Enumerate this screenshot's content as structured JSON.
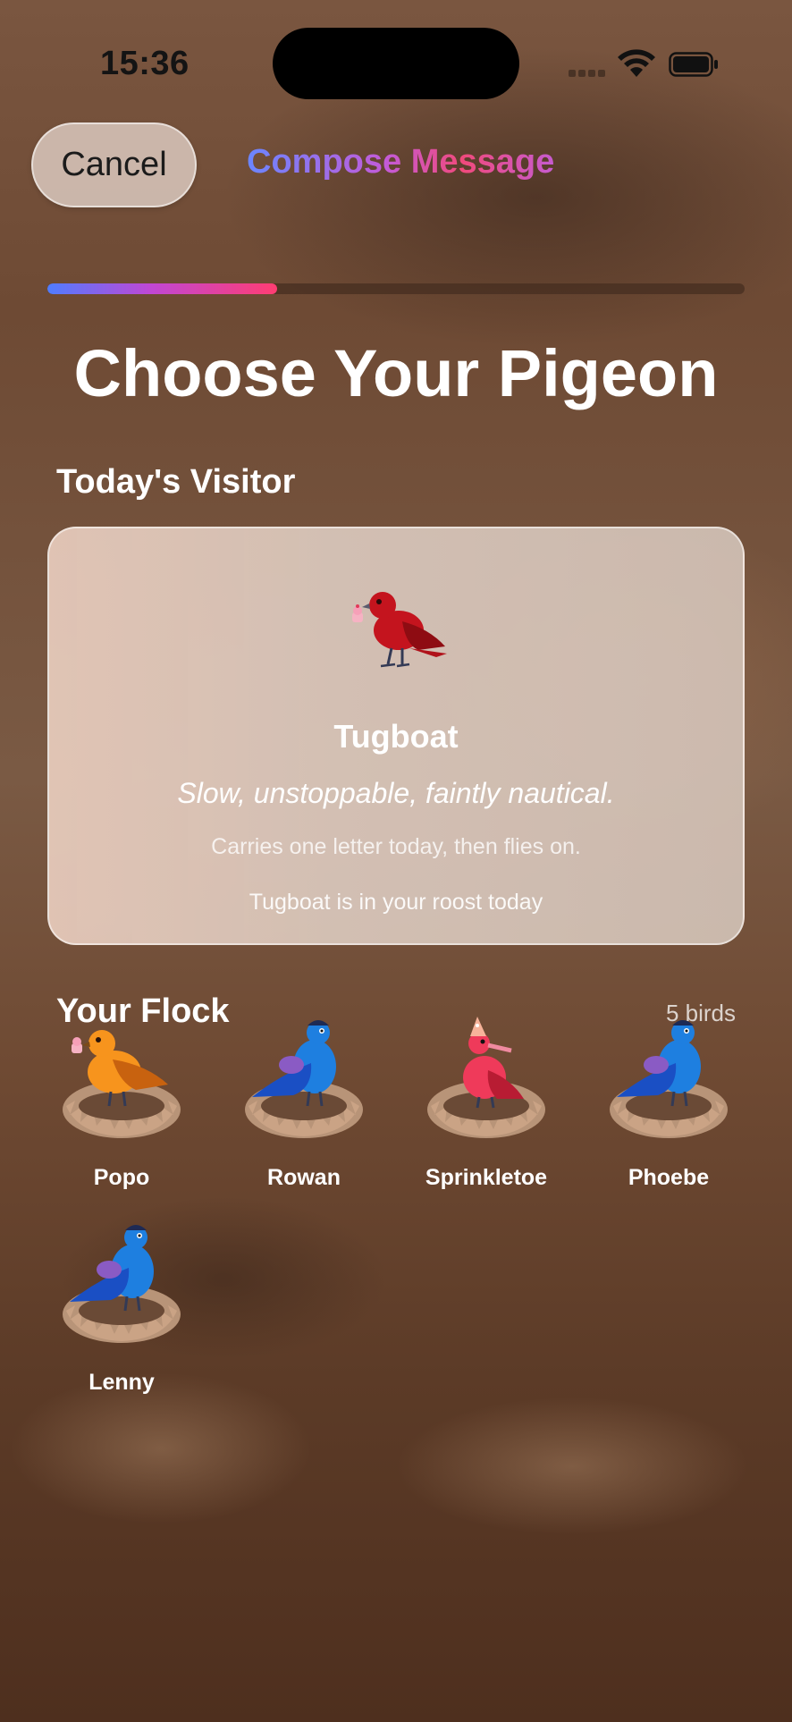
{
  "status_bar": {
    "time": "15:36"
  },
  "nav": {
    "cancel_label": "Cancel",
    "title": "Compose Message"
  },
  "progress": {
    "value": 0.33
  },
  "page_title": "Choose Your Pigeon",
  "visitor_section": {
    "title": "Today's Visitor",
    "card": {
      "bird_icon": "red-pigeon-with-cupcake",
      "name": "Tugboat",
      "tagline": "Slow, unstoppable, faintly nautical.",
      "note": "Carries one letter today, then flies on.",
      "status": "Tugboat is in your roost today"
    }
  },
  "flock_section": {
    "title": "Your Flock",
    "count_label": "5 birds",
    "birds": [
      {
        "name": "Popo",
        "icon": "orange-pigeon-with-cupcake"
      },
      {
        "name": "Rowan",
        "icon": "blue-pigeon-with-cap"
      },
      {
        "name": "Sprinkletoe",
        "icon": "pink-pigeon-with-party-hat"
      },
      {
        "name": "Phoebe",
        "icon": "blue-pigeon-with-cap"
      },
      {
        "name": "Lenny",
        "icon": "blue-pigeon-with-cap"
      }
    ]
  },
  "colors": {
    "accent_blue": "#4f7dff",
    "accent_purple": "#c047d4",
    "accent_pink": "#ff3d72"
  }
}
